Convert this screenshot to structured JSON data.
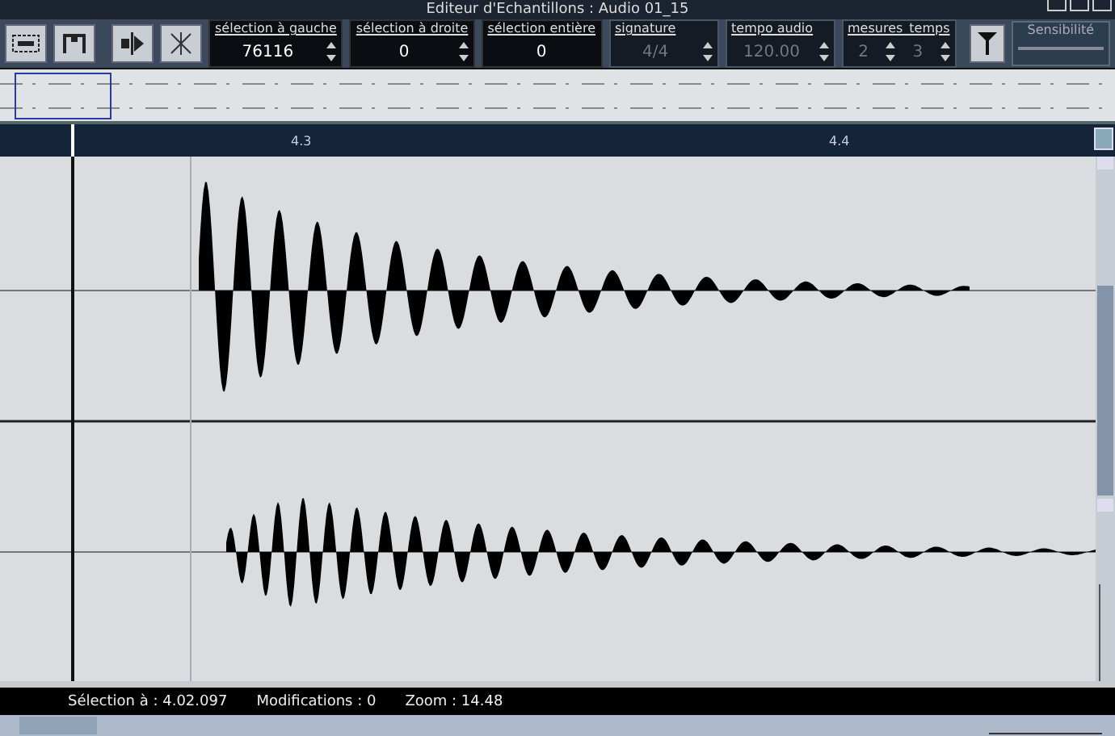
{
  "window": {
    "title": "Editeur d'Echantillons : Audio 01_15"
  },
  "toolbar": {
    "fields": [
      {
        "label": "sélection à gauche",
        "values": [
          "76116"
        ],
        "spinner": true,
        "disabled": false
      },
      {
        "label": "sélection à droite",
        "values": [
          "0"
        ],
        "spinner": true,
        "disabled": false
      },
      {
        "label": "sélection entière",
        "values": [
          "0"
        ],
        "spinner": false,
        "disabled": false
      },
      {
        "label": "signature",
        "values": [
          "4/4"
        ],
        "spinner": true,
        "disabled": true
      },
      {
        "label": "tempo audio",
        "values": [
          "120.00"
        ],
        "spinner": true,
        "disabled": true
      },
      {
        "label": "mesures_temps",
        "values": [
          "2",
          "3"
        ],
        "spinner": true,
        "disabled": true
      }
    ],
    "sensitivity": {
      "label": "Sensibilité"
    }
  },
  "ruler": {
    "ticks": [
      "4.3",
      "4.4"
    ]
  },
  "status_bar": {
    "items": [
      "Sélection à : 4.02.097",
      "Modifications : 0",
      "Zoom : 14.48"
    ]
  }
}
